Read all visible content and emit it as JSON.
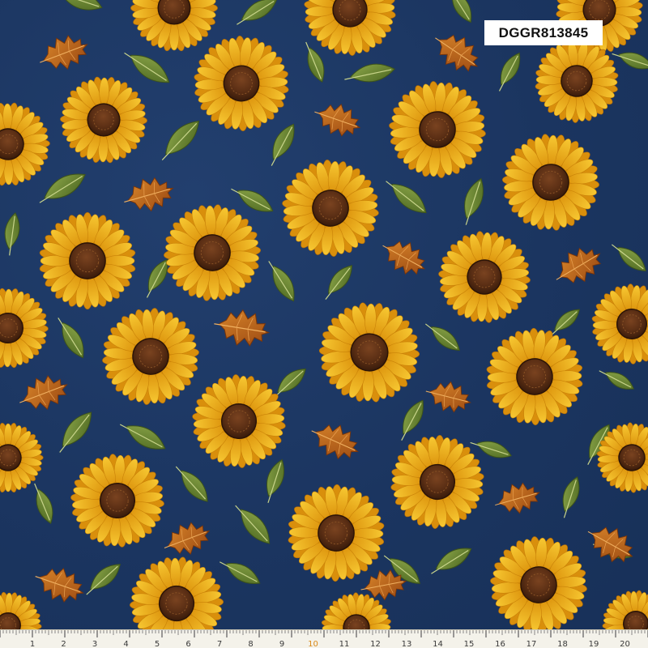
{
  "product_code": "DGGR813845",
  "colors": {
    "background": "#1b3560",
    "sunflower_petal": "#f2b418",
    "sunflower_petal_shade": "#d98f0c",
    "sunflower_center": "#5a2e14",
    "leaf_green": "#6f8a34",
    "leaf_autumn": "#c0621c",
    "ruler": "#f4f2ea",
    "ruler_accent": "#d9891a"
  },
  "pattern": {
    "motifs": [
      "sunflower",
      "green-leaf",
      "autumn-oak-leaf"
    ]
  },
  "ruler": {
    "labels": [
      "1",
      "2",
      "3",
      "4",
      "5",
      "6",
      "7",
      "8",
      "9",
      "10",
      "11",
      "12",
      "13",
      "14",
      "15",
      "16",
      "17",
      "18",
      "19",
      "20"
    ],
    "accent_label": "10"
  }
}
